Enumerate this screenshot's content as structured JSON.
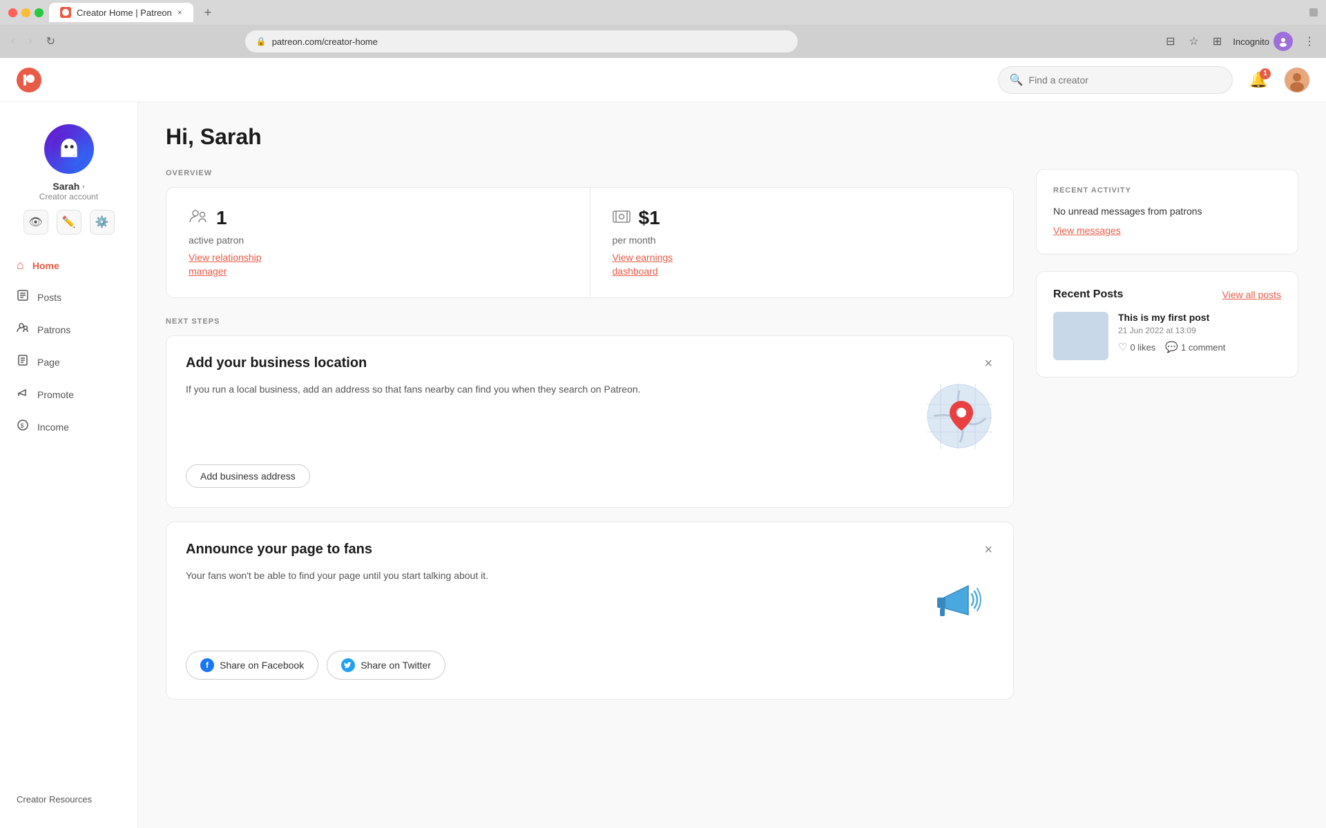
{
  "browser": {
    "tab_title": "Creator Home | Patreon",
    "tab_close": "×",
    "new_tab": "+",
    "address": "patreon.com/creator-home",
    "incognito_label": "Incognito",
    "back_btn": "‹",
    "forward_btn": "›",
    "reload_btn": "↻"
  },
  "topnav": {
    "logo_letter": "P",
    "search_placeholder": "Find a creator",
    "bell_badge": "1"
  },
  "sidebar": {
    "profile_name": "Sarah",
    "profile_chevron": "›",
    "profile_role": "Creator account",
    "nav_items": [
      {
        "id": "home",
        "label": "Home",
        "icon": "⌂",
        "active": true
      },
      {
        "id": "posts",
        "label": "Posts",
        "icon": "📝",
        "active": false
      },
      {
        "id": "patrons",
        "label": "Patrons",
        "icon": "👥",
        "active": false
      },
      {
        "id": "page",
        "label": "Page",
        "icon": "📄",
        "active": false
      },
      {
        "id": "promote",
        "label": "Promote",
        "icon": "📢",
        "active": false
      },
      {
        "id": "income",
        "label": "Income",
        "icon": "💰",
        "active": false
      }
    ],
    "creator_resources": "Creator Resources"
  },
  "main": {
    "greeting": "Hi, Sarah",
    "overview_label": "OVERVIEW",
    "stats": [
      {
        "id": "patrons",
        "number": "1",
        "label": "active patron",
        "link_line1": "View relationship",
        "link_line2": "manager"
      },
      {
        "id": "earnings",
        "number": "$1",
        "label": "per month",
        "link_line1": "View earnings",
        "link_line2": "dashboard"
      }
    ],
    "next_steps_label": "NEXT STEPS",
    "step_cards": [
      {
        "id": "business-location",
        "title": "Add your business location",
        "body": "If you run a local business, add an address so that fans nearby can find you when they search on Patreon.",
        "action_label": "Add business address",
        "illustration": "map"
      },
      {
        "id": "announce-page",
        "title": "Announce your page to fans",
        "body": "Your fans won't be able to find your page until you start talking about it.",
        "illustration": "megaphone",
        "social_buttons": [
          {
            "id": "facebook",
            "label": "Share on Facebook",
            "icon": "fb"
          },
          {
            "id": "twitter",
            "label": "Share on Twitter",
            "icon": "tw"
          }
        ]
      }
    ],
    "recent_activity_label": "RECENT ACTIVITY",
    "no_messages_text": "No unread messages from patrons",
    "view_messages_label": "View messages",
    "recent_posts_title": "Recent Posts",
    "view_all_posts_label": "View all posts",
    "posts": [
      {
        "title": "This is my first post",
        "date": "21 Jun 2022 at 13:09",
        "likes": "0 likes",
        "comments": "1 comment"
      }
    ]
  }
}
